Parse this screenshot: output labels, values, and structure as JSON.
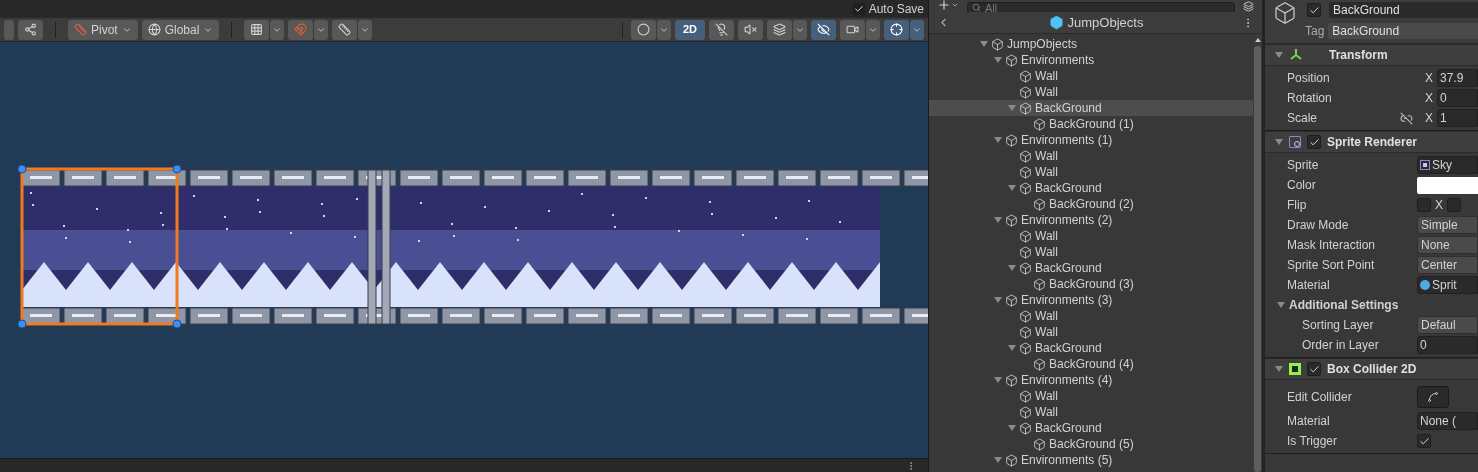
{
  "scene_view": {
    "auto_save": {
      "label": "Auto Save",
      "checked": true
    },
    "handle_tools": [
      {
        "kind": "pivot",
        "label": "Pivot"
      },
      {
        "kind": "global",
        "label": "Global"
      }
    ],
    "mode_2d": {
      "label": "2D",
      "selected": true
    },
    "view_toggles": [
      {
        "kind": "lighting",
        "selected": false
      },
      {
        "kind": "audio",
        "selected": false
      },
      {
        "kind": "effects",
        "selected": false
      },
      {
        "kind": "visibility",
        "selected": true
      },
      {
        "kind": "camera",
        "selected": false
      },
      {
        "kind": "gizmos",
        "selected": true
      }
    ]
  },
  "hierarchy": {
    "search": {
      "placeholder": "All"
    },
    "title": "JumpObjects",
    "tree": [
      {
        "name": "JumpObjects",
        "expanded": true,
        "selected": false,
        "children": [
          {
            "name": "Environments",
            "expanded": true,
            "selected": false,
            "children": [
              {
                "name": "Wall",
                "selected": false
              },
              {
                "name": "Wall",
                "selected": false
              },
              {
                "name": "BackGround",
                "expanded": true,
                "selected": true,
                "children": [
                  {
                    "name": "BackGround (1)",
                    "selected": false
                  }
                ]
              }
            ]
          },
          {
            "name": "Environments (1)",
            "expanded": true,
            "selected": false,
            "children": [
              {
                "name": "Wall",
                "selected": false
              },
              {
                "name": "Wall",
                "selected": false
              },
              {
                "name": "BackGround",
                "expanded": true,
                "selected": false,
                "children": [
                  {
                    "name": "BackGround (2)",
                    "selected": false
                  }
                ]
              }
            ]
          },
          {
            "name": "Environments (2)",
            "expanded": true,
            "selected": false,
            "children": [
              {
                "name": "Wall",
                "selected": false
              },
              {
                "name": "Wall",
                "selected": false
              },
              {
                "name": "BackGround",
                "expanded": true,
                "selected": false,
                "children": [
                  {
                    "name": "BackGround (3)",
                    "selected": false
                  }
                ]
              }
            ]
          },
          {
            "name": "Environments (3)",
            "expanded": true,
            "selected": false,
            "children": [
              {
                "name": "Wall",
                "selected": false
              },
              {
                "name": "Wall",
                "selected": false
              },
              {
                "name": "BackGround",
                "expanded": true,
                "selected": false,
                "children": [
                  {
                    "name": "BackGround (4)",
                    "selected": false
                  }
                ]
              }
            ]
          },
          {
            "name": "Environments (4)",
            "expanded": true,
            "selected": false,
            "children": [
              {
                "name": "Wall",
                "selected": false
              },
              {
                "name": "Wall",
                "selected": false
              },
              {
                "name": "BackGround",
                "expanded": true,
                "selected": false,
                "children": [
                  {
                    "name": "BackGround (5)",
                    "selected": false
                  }
                ]
              }
            ]
          },
          {
            "name": "Environments (5)",
            "expanded": true,
            "selected": false
          }
        ]
      }
    ]
  },
  "inspector": {
    "object": {
      "active": true,
      "name": "BackGround",
      "tag_label": "Tag",
      "tag": "BackGround"
    },
    "components": [
      {
        "kind": "transform",
        "name": "Transform",
        "expanded": true,
        "properties": [
          {
            "kind": "vector",
            "label": "Position",
            "axis": "X",
            "value": "37.9"
          },
          {
            "kind": "vector",
            "label": "Rotation",
            "axis": "X",
            "value": "0"
          },
          {
            "kind": "vector",
            "label": "Scale",
            "axis": "X",
            "value": "1",
            "linked": false
          }
        ]
      },
      {
        "kind": "sprite_renderer",
        "name": "Sprite Renderer",
        "expanded": true,
        "enabled": true,
        "properties": [
          {
            "kind": "sprite",
            "label": "Sprite",
            "value": "Sky"
          },
          {
            "kind": "color",
            "label": "Color",
            "color": "#ffffff"
          },
          {
            "kind": "flip",
            "label": "Flip",
            "axis": "X",
            "x_checked": false,
            "y_checked": false
          },
          {
            "kind": "dropdown",
            "label": "Draw Mode",
            "value": "Simple"
          },
          {
            "kind": "dropdown",
            "label": "Mask Interaction",
            "value": "None"
          },
          {
            "kind": "dropdown",
            "label": "Sprite Sort Point",
            "value": "Center"
          },
          {
            "kind": "material",
            "label": "Material",
            "value": "Sprit"
          },
          {
            "kind": "section",
            "label": "Additional Settings",
            "expanded": true,
            "children": [
              {
                "kind": "dropdown",
                "label": "Sorting Layer",
                "value": "Defaul"
              },
              {
                "kind": "number",
                "label": "Order in Layer",
                "value": "0"
              }
            ]
          }
        ]
      },
      {
        "kind": "box_collider",
        "name": "Box Collider 2D",
        "expanded": true,
        "enabled": true,
        "properties": [
          {
            "kind": "button",
            "label": "Edit Collider"
          },
          {
            "kind": "object",
            "label": "Material",
            "value": "None ("
          },
          {
            "kind": "toggle",
            "label": "Is Trigger",
            "checked": true
          }
        ]
      }
    ]
  }
}
